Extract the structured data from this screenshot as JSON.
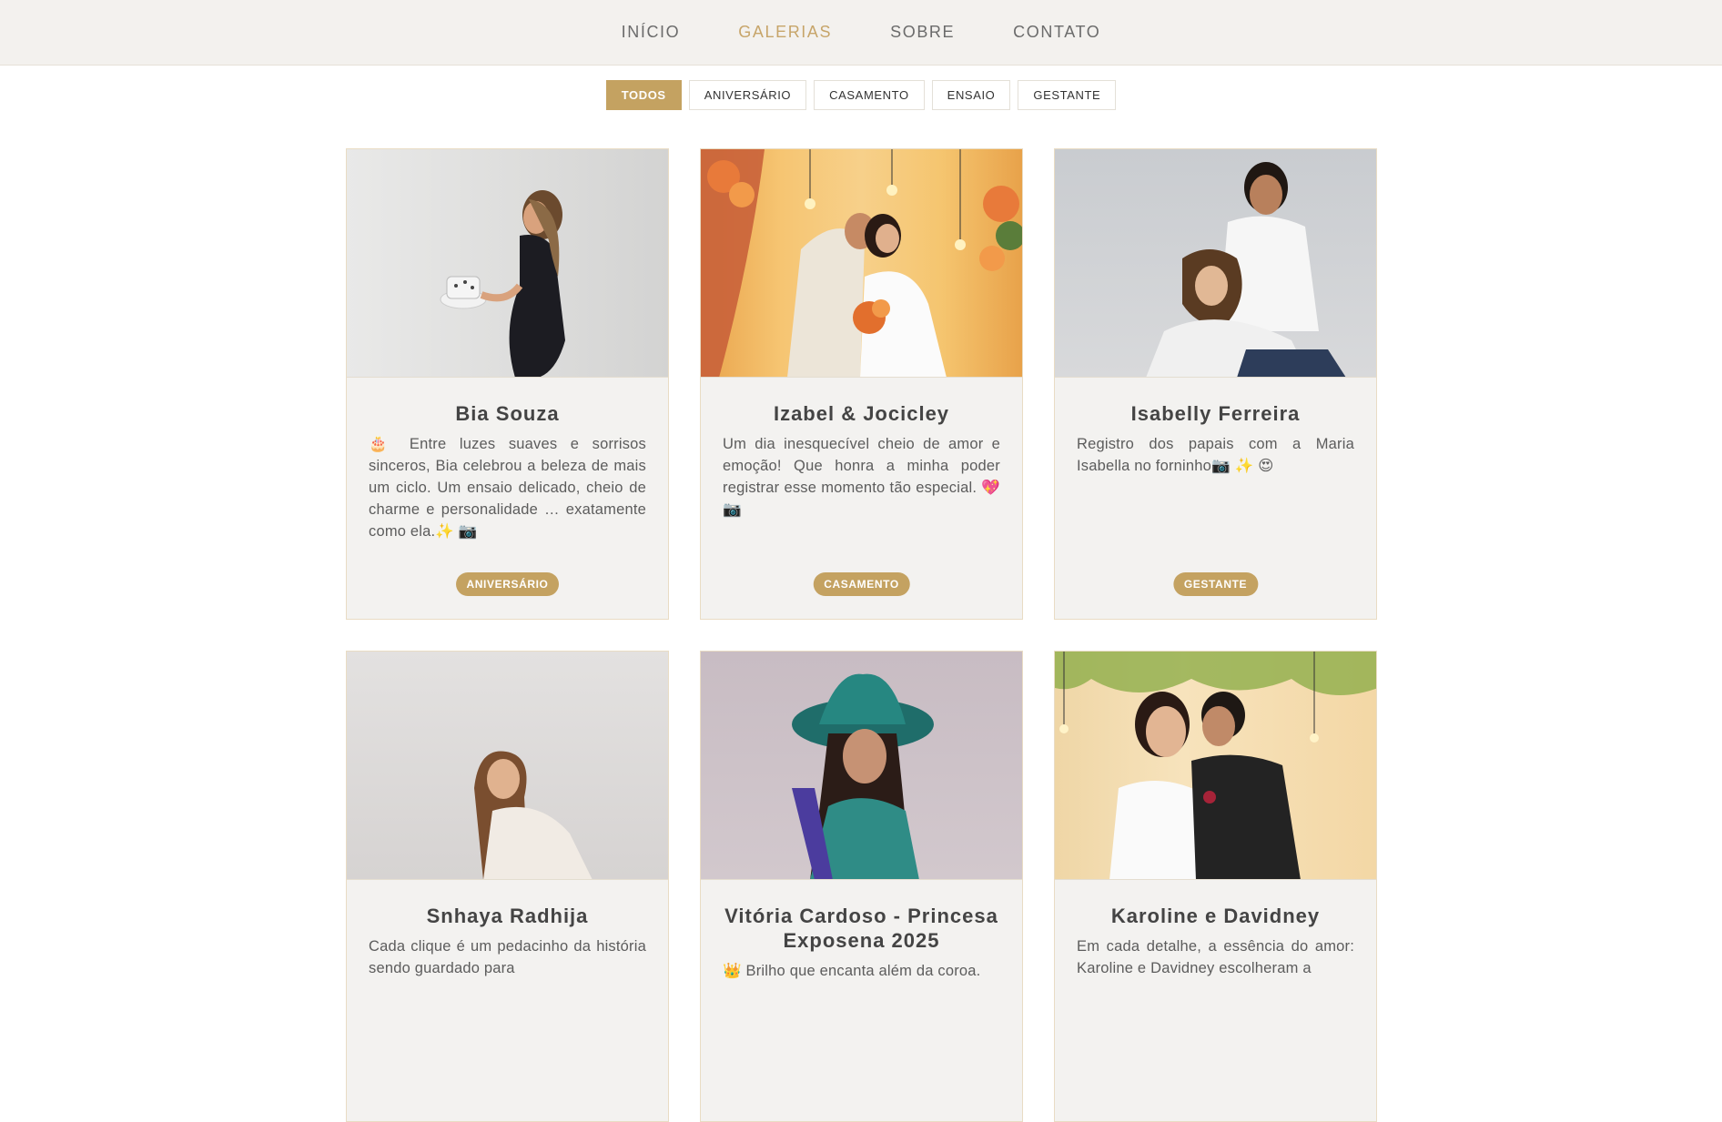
{
  "nav": {
    "items": [
      {
        "label": "INÍCIO",
        "active": false
      },
      {
        "label": "GALERIAS",
        "active": true
      },
      {
        "label": "SOBRE",
        "active": false
      },
      {
        "label": "CONTATO",
        "active": false
      }
    ]
  },
  "filters": [
    {
      "label": "TODOS",
      "active": true
    },
    {
      "label": "ANIVERSÁRIO",
      "active": false
    },
    {
      "label": "CASAMENTO",
      "active": false
    },
    {
      "label": "ENSAIO",
      "active": false
    },
    {
      "label": "GESTANTE",
      "active": false
    }
  ],
  "accent_color": "#c4a261",
  "cards": [
    {
      "title": "Bia Souza",
      "description": "🎂 Entre luzes suaves e sorrisos sinceros, Bia celebrou a beleza de mais um ciclo. Um ensaio delicado, cheio de charme e personalidade … exatamente como ela.✨ 📷",
      "category": "ANIVERSÁRIO"
    },
    {
      "title": "Izabel & Jocicley",
      "description": "Um dia inesquecível cheio de amor e emoção! Que honra a minha poder registrar esse momento tão especial. 💖 📷",
      "category": "CASAMENTO"
    },
    {
      "title": "Isabelly Ferreira",
      "description": "Registro dos papais com a Maria Isabella no forninho📷 ✨ 😍",
      "category": "GESTANTE"
    },
    {
      "title": "Snhaya Radhija",
      "description": "Cada clique é um pedacinho da história sendo guardado para",
      "category": ""
    },
    {
      "title": "Vitória Cardoso - Princesa Exposena 2025",
      "description": "👑 Brilho que encanta além da coroa.",
      "category": ""
    },
    {
      "title": "Karoline e Davidney",
      "description": "Em cada detalhe, a essência do amor: Karoline e Davidney escolheram a",
      "category": ""
    }
  ]
}
